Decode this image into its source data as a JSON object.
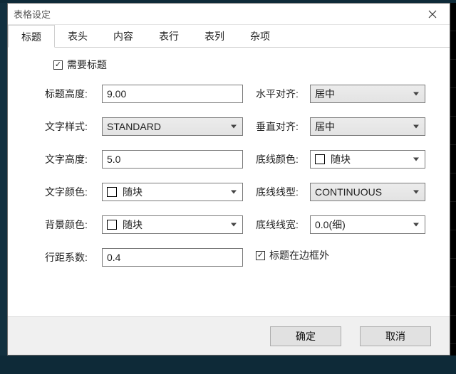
{
  "window": {
    "title": "表格设定"
  },
  "tabs": {
    "t0": "标题",
    "t1": "表头",
    "t2": "内容",
    "t3": "表行",
    "t4": "表列",
    "t5": "杂项"
  },
  "need_title": {
    "label": "需要标题",
    "checked": true
  },
  "left": {
    "title_height": {
      "label": "标题高度:",
      "value": "9.00"
    },
    "text_style": {
      "label": "文字样式:",
      "value": "STANDARD"
    },
    "text_height": {
      "label": "文字高度:",
      "value": "5.0"
    },
    "text_color": {
      "label": "文字颜色:",
      "value": "随块"
    },
    "bg_color": {
      "label": "背景颜色:",
      "value": "随块"
    },
    "line_spacing": {
      "label": "行距系数:",
      "value": "0.4"
    }
  },
  "right": {
    "halign": {
      "label": "水平对齐:",
      "value": "居中"
    },
    "valign": {
      "label": "垂直对齐:",
      "value": "居中"
    },
    "line_color": {
      "label": "底线颜色:",
      "value": "随块"
    },
    "line_type": {
      "label": "底线线型:",
      "value": "CONTINUOUS"
    },
    "line_width": {
      "label": "底线线宽:",
      "value": "0.0(细)"
    },
    "title_outside": {
      "label": "标题在边框外",
      "checked": true
    }
  },
  "footer": {
    "ok": "确定",
    "cancel": "取消"
  }
}
